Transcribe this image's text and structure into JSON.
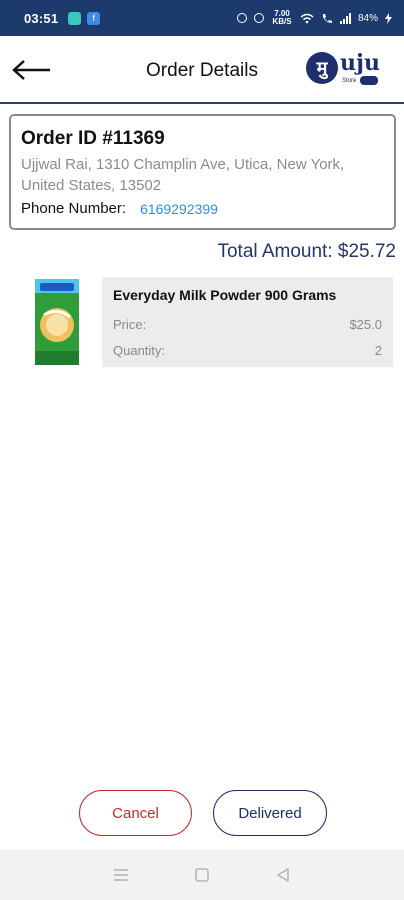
{
  "status_bar": {
    "time": "03:51",
    "network": "7.00 KB/S",
    "battery": "84%",
    "app_icon_b": "f"
  },
  "header": {
    "title": "Order Details",
    "logo_letter": "मु",
    "logo_text": "uju",
    "logo_sub": "Store"
  },
  "order": {
    "id_label": "Order ID #11369",
    "address": "Ujjwal Rai, 1310 Champlin Ave, Utica, New York, United States, 13502",
    "phone_label": "Phone Number:",
    "phone_value": "6169292399"
  },
  "total": {
    "label": "Total Amount: $25.72"
  },
  "product": {
    "name": "Everyday Milk Powder 900 Grams",
    "price_label": "Price:",
    "price_value": "$25.0",
    "quantity_label": "Quantity:",
    "quantity_value": "2",
    "image_icon": "milk-powder-pack"
  },
  "actions": {
    "cancel_label": "Cancel",
    "delivered_label": "Delivered"
  },
  "colors": {
    "status_bar": "#1c3a6b",
    "accent": "#23376a",
    "cancel": "#c52b2b",
    "link": "#2f8fe0"
  }
}
